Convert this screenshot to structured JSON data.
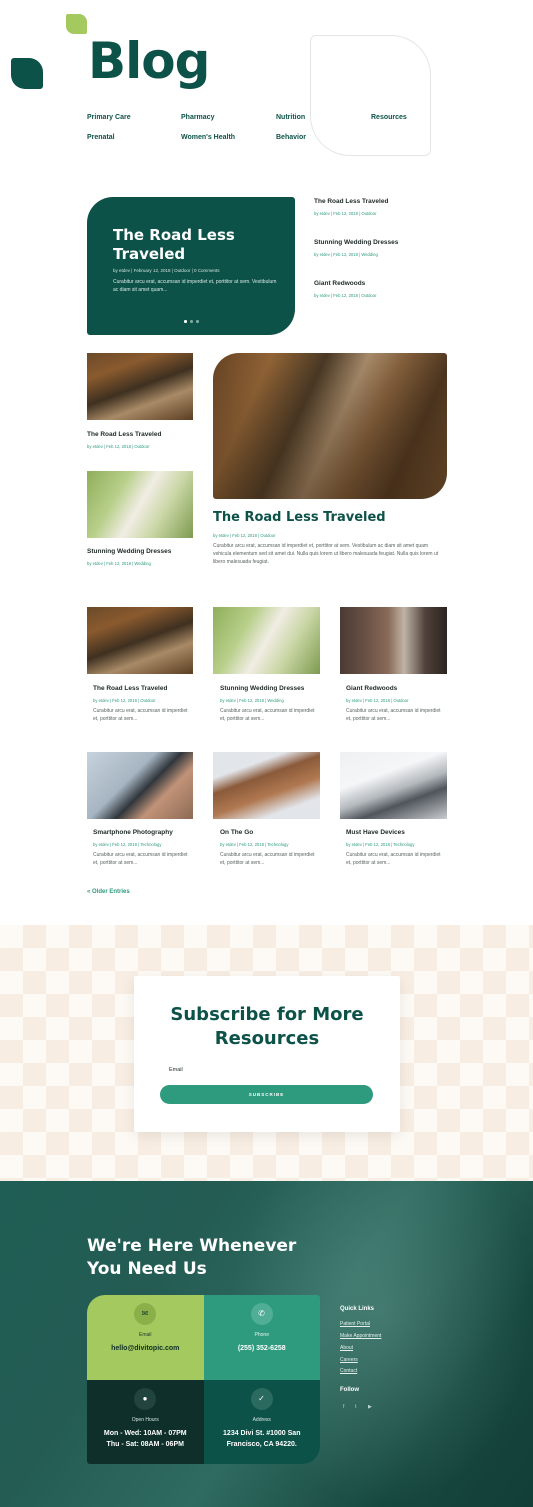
{
  "header": {
    "title": "Blog",
    "nav": [
      "Primary Care",
      "Pharmacy",
      "Nutrition",
      "Resources",
      "Prenatal",
      "Women's Health",
      "Behavior"
    ]
  },
  "featured": {
    "title": "The Road Less Traveled",
    "meta": "by etdev | February 12, 2018 | Outdoor | 0 Comments",
    "excerpt": "Curabitur arcu erat, accumsan id imperdiet et, porttitor at sem. Vestibulum ac diam sit amet quam..."
  },
  "side_posts": [
    {
      "title": "The Road Less Traveled",
      "meta": "by etdev | Feb 12, 2018 | Outdoor"
    },
    {
      "title": "Stunning Wedding Dresses",
      "meta": "by etdev | Feb 12, 2018 | Wedding"
    },
    {
      "title": "Giant Redwoods",
      "meta": "by etdev | Feb 12, 2018 | Outdoor"
    }
  ],
  "mosaic": {
    "small": [
      {
        "title": "The Road Less Traveled",
        "meta": "by etdev | Feb 12, 2018 | Outdoor"
      },
      {
        "title": "Stunning Wedding Dresses",
        "meta": "by etdev | Feb 12, 2018 | Wedding"
      }
    ],
    "big": {
      "title": "The Road Less Traveled",
      "meta": "by etdev | Feb 12, 2018 | Outdoor",
      "excerpt": "Curabitur arcu erat, accumsan id imperdiet et, porttitor at sem. Vestibulum ac diam sit amet quam vehicula elementum sed sit amet dui. Nulla quis lorem ut libero malesuada feugiat. Nulla quis lorem ut libero malesuada feugiat."
    }
  },
  "grid": [
    {
      "title": "The Road Less Traveled",
      "meta": "by etdev | Feb 12, 2018 | Outdoor",
      "excerpt": "Curabitur arcu erat, accumsan id imperdiet et, porttitor at sem..."
    },
    {
      "title": "Stunning Wedding Dresses",
      "meta": "by etdev | Feb 12, 2018 | Wedding",
      "excerpt": "Curabitur arcu erat, accumsan id imperdiet et, porttitor at sem..."
    },
    {
      "title": "Giant Redwoods",
      "meta": "by etdev | Feb 12, 2018 | Outdoor",
      "excerpt": "Curabitur arcu erat, accumsan id imperdiet et, porttitor at sem..."
    },
    {
      "title": "Smartphone Photography",
      "meta": "by etdev | Feb 12, 2018 | Technology",
      "excerpt": "Curabitur arcu erat, accumsan id imperdiet et, porttitor at sem..."
    },
    {
      "title": "On The Go",
      "meta": "by etdev | Feb 12, 2018 | Technology",
      "excerpt": "Curabitur arcu erat, accumsan id imperdiet et, porttitor at sem..."
    },
    {
      "title": "Must Have Devices",
      "meta": "by etdev | Feb 12, 2018 | Technology",
      "excerpt": "Curabitur arcu erat, accumsan id imperdiet et, porttitor at sem..."
    }
  ],
  "older_entries": "« Older Entries",
  "subscribe": {
    "title": "Subscribe for More Resources",
    "email_label": "Email",
    "button": "SUBSCRIBE"
  },
  "footer": {
    "title": "We're Here Whenever You Need Us",
    "contact": [
      {
        "label": "Email",
        "value": "hello@divitopic.com",
        "icon": "envelope-icon"
      },
      {
        "label": "Phone",
        "value": "(255) 352-6258",
        "icon": "phone-icon"
      },
      {
        "label": "Open Hours",
        "value": "Mon - Wed: 10AM - 07PM",
        "value2": "Thu - Sat: 08AM - 06PM",
        "icon": "clock-icon"
      },
      {
        "label": "Address",
        "value": "1234 Divi St. #1000 San",
        "value2": "Francisco, CA 94220.",
        "icon": "location-icon"
      }
    ],
    "quick_links_title": "Quick Links",
    "quick_links": [
      "Patient Portal",
      "Make Appointment",
      "About",
      "Careers",
      "Contact"
    ],
    "follow_title": "Follow",
    "social": [
      "facebook-icon",
      "twitter-icon",
      "youtube-icon"
    ]
  },
  "colors": {
    "primary": "#0d5248",
    "accent": "#2e9a7e",
    "lime": "#a4c95f"
  }
}
